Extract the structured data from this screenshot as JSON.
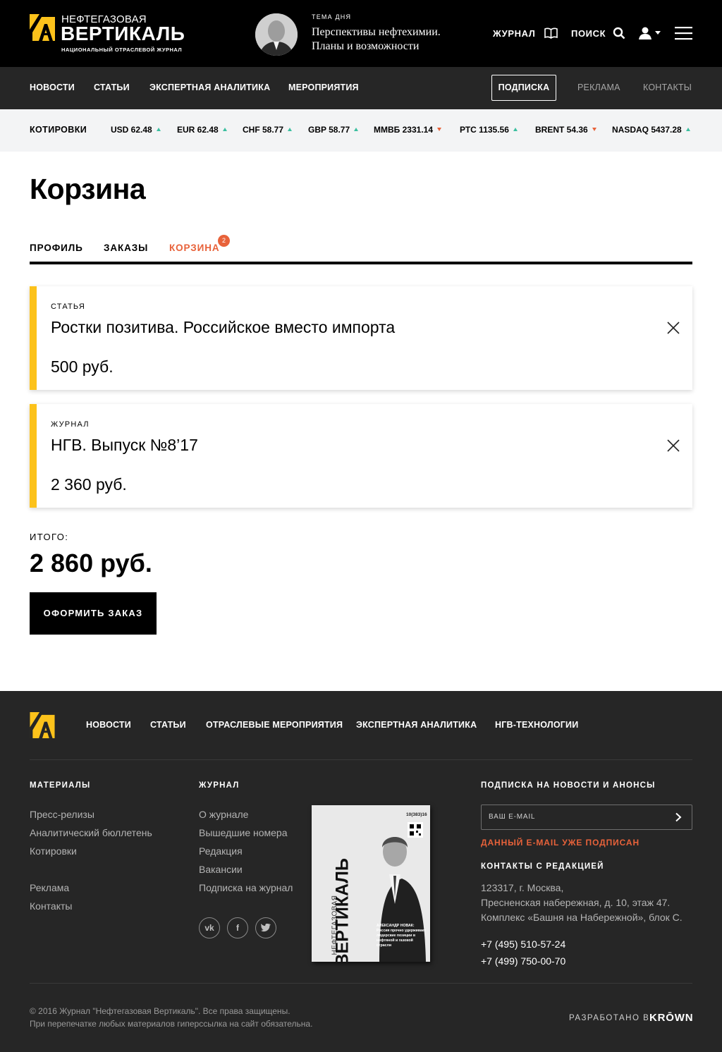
{
  "header": {
    "logo_top": "НЕФТЕГАЗОВАЯ",
    "logo_main": "ВЕРТИКАЛЬ",
    "logo_sub": "НАЦИОНАЛЬНЫЙ ОТРАСЛЕВОЙ ЖУРНАЛ",
    "topic_label": "ТЕМА ДНЯ",
    "topic_line1": "Перспективы нефтехимии.",
    "topic_line2": "Планы и возможности",
    "journal_label": "ЖУРНАЛ",
    "search_label": "ПОИСК",
    "brand_color": "#fcc21b"
  },
  "nav": {
    "items": [
      "НОВОСТИ",
      "СТАТЬИ",
      "ЭКСПЕРТНАЯ АНАЛИТИКА",
      "МЕРОПРИЯТИЯ"
    ],
    "subscribe": "ПОДПИСКА",
    "ads": "РЕКЛАМА",
    "contacts": "КОНТАКТЫ"
  },
  "quotes": {
    "label": "КОТИРОВКИ",
    "items": [
      {
        "text": "USD 62.48",
        "trend": "up"
      },
      {
        "text": "EUR 62.48",
        "trend": "up"
      },
      {
        "text": "CHF 58.77",
        "trend": "up"
      },
      {
        "text": "GBP 58.77",
        "trend": "up"
      },
      {
        "text": "ММВБ 2331.14",
        "trend": "down"
      },
      {
        "text": "РТС 1135.56",
        "trend": "up"
      },
      {
        "text": "BRENT 54.36",
        "trend": "down"
      },
      {
        "text": "NASDAQ 5437.28",
        "trend": "up"
      }
    ],
    "up_color": "#3bbfa0",
    "down_color": "#e8623a"
  },
  "page": {
    "title": "Корзина",
    "tabs": [
      "ПРОФИЛЬ",
      "ЗАКАЗЫ",
      "КОРЗИНА"
    ],
    "active_tab": "КОРЗИНА",
    "cart_badge": "2",
    "accent_color": "#e8623a"
  },
  "cart": {
    "items": [
      {
        "type": "СТАТЬЯ",
        "title": "Ростки позитива. Российское вместо импорта",
        "price": "500 руб."
      },
      {
        "type": "ЖУРНАЛ",
        "title": "НГВ. Выпуск №8’17",
        "price": "2 360 руб."
      }
    ],
    "total_label": "ИТОГО:",
    "total_value": "2 860 руб.",
    "order_button": "ОФОРМИТЬ ЗАКАЗ"
  },
  "footer": {
    "nav": [
      "НОВОСТИ",
      "СТАТЬИ",
      "ОТРАСЛЕВЫЕ МЕРОПРИЯТИЯ",
      "ЭКСПЕРТНАЯ АНАЛИТИКА",
      "НГВ-ТЕХНОЛОГИИ"
    ],
    "materials_title": "МАТЕРИАЛЫ",
    "materials": [
      "Пресс-релизы",
      "Аналитический бюллетень",
      "Котировки"
    ],
    "materials_extra": [
      "Реклама",
      "Контакты"
    ],
    "journal_title": "ЖУРНАЛ",
    "journal_links": [
      "О журнале",
      "Вышедшие номера",
      "Редакция",
      "Вакансии",
      "Подписка на журнал"
    ],
    "social": [
      "vk-icon",
      "facebook-icon",
      "twitter-icon"
    ],
    "cover": {
      "issue": "10(383)16",
      "title_top": "НЕФТЕГАЗОВАЯ",
      "title_main": "ВЕРТИКАЛЬ",
      "headline_name": "АЛЕКСАНДР НОВАК:",
      "headline_text": "Россия прочно удерживает лидерские позиции в нефтяной и газовой отрасли"
    },
    "subscribe_title": "ПОДПИСКА НА НОВОСТИ И АНОНСЫ",
    "email_placeholder": "ВАШ E-MAIL",
    "email_error": "ДАННЫЙ E-MAIL УЖЕ ПОДПИСАН",
    "contacts_title": "КОНТАКТЫ С РЕДАКЦИЕЙ",
    "address": [
      "123317, г. Москва,",
      "Пресненская набережная, д. 10, этаж 47.",
      "Комплекс «Башня на Набережной», блок С."
    ],
    "phones": [
      "+7 (495) 510-57-24",
      "+7 (499) 750-00-70"
    ],
    "copyright": "© 2016 Журнал \"Нефтегазовая Вертикаль\". Все права защищены.",
    "reprint": "При перепечатке любых материалов гиперссылка на сайт обязательна.",
    "developed_by": "РАЗРАБОТАНО В",
    "developer": "KRŌWN"
  }
}
